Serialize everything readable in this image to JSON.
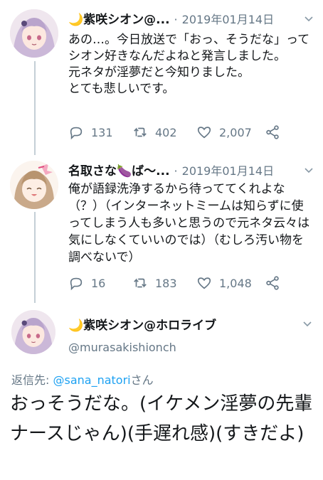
{
  "tweets": [
    {
      "name": "🌙紫咲シオン@...",
      "separator": "·",
      "date": "2019年01月14日",
      "text": "あの…。今日放送で「おっ、そうだな」ってシオン好きなんだよねと発言しました。\n元ネタが淫夢だと今知りました。\nとても悲しいです。",
      "replies": "131",
      "retweets": "402",
      "likes": "2,007"
    },
    {
      "name": "名取さな🍆ば〜...",
      "separator": "·",
      "date": "2019年01月14日",
      "text": "俺が語録洗浄するから待っててくれよな（？）（インターネットミームは知らずに使ってしまう人も多いと思うので元ネタ云々は気にしなくていいのでは）（むしろ汚い物を調べないで）",
      "replies": "16",
      "retweets": "183",
      "likes": "1,048"
    }
  ],
  "main_tweet": {
    "name": "🌙紫咲シオン@ホロライブ",
    "handle": "@murasakishionch",
    "reply_prefix": "返信先: ",
    "reply_handle": "@sana_natori",
    "reply_suffix": "さん",
    "text": "おっそうだな。(イケメン淫夢の先輩ナースじゃん)(手遅れ感)(すきだよ)"
  },
  "icons": [
    "reply-icon",
    "retweet-icon",
    "like-icon",
    "share-icon",
    "chevron-down-icon"
  ],
  "colors": {
    "accent": "#1da1f2",
    "muted": "#657786",
    "thread_line": "#c4cfd6",
    "text": "#14171a"
  }
}
